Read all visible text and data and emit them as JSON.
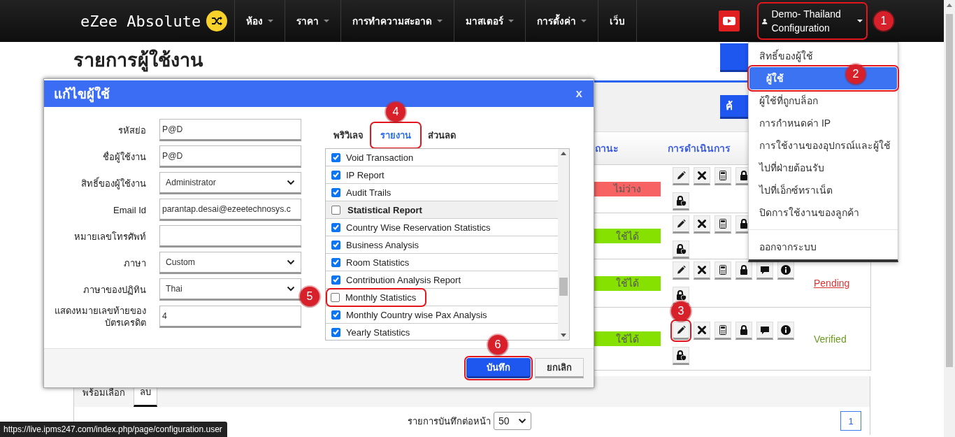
{
  "navbar": {
    "logo": "eZee Absolute",
    "menus": [
      {
        "label": "ห้อง",
        "has_caret": true
      },
      {
        "label": "ราคา",
        "has_caret": true
      },
      {
        "label": "การทำความสะอาด",
        "has_caret": true
      },
      {
        "label": "มาสเตอร์",
        "has_caret": true
      },
      {
        "label": "การตั้งค่า",
        "has_caret": true
      },
      {
        "label": "เว็บ",
        "has_caret": false
      }
    ],
    "user": {
      "label": "Demo- Thailand Configuration",
      "highlighted": true,
      "callout": "1"
    }
  },
  "user_menu": [
    {
      "kind": "item",
      "label": "สิทธิ์ของผู้ใช้",
      "selected": false,
      "highlighted": false
    },
    {
      "kind": "item",
      "label": "ผู้ใช้",
      "selected": true,
      "highlighted": true,
      "callout": "2"
    },
    {
      "kind": "item",
      "label": "ผู้ใช้ที่ถูกบล็อก",
      "selected": false,
      "highlighted": false
    },
    {
      "kind": "item",
      "label": "การกำหนดค่า IP",
      "selected": false,
      "highlighted": false
    },
    {
      "kind": "item",
      "label": "การใช้งานของอุปกรณ์และผู้ใช้",
      "selected": false,
      "highlighted": false
    },
    {
      "kind": "item",
      "label": "ไปที่ฝ่ายต้อนรับ",
      "selected": false,
      "highlighted": false
    },
    {
      "kind": "item",
      "label": "ไปที่เอ็กซ์ทราเน็ต",
      "selected": false,
      "highlighted": false
    },
    {
      "kind": "item",
      "label": "ปิดการใช้งานของลูกค้า",
      "selected": false,
      "highlighted": false
    },
    {
      "kind": "divider"
    },
    {
      "kind": "item",
      "label": "ออกจากระบบ",
      "selected": false,
      "highlighted": false
    }
  ],
  "page": {
    "title": "รายการผู้ใช้งาน",
    "search_button": "ค้",
    "columns": [
      "ถานะ",
      "การดำเนินการ"
    ],
    "rows": [
      {
        "status": "ไม่ว่าง",
        "color": "#f76262",
        "actions": [
          {
            "kind": "edit",
            "highlighted": false
          },
          {
            "kind": "delete",
            "highlighted": false
          },
          {
            "kind": "calculator",
            "highlighted": false
          },
          {
            "kind": "lock",
            "highlighted": false
          },
          {
            "kind": "lock-shield",
            "highlighted": false
          }
        ]
      },
      {
        "status": "ใช้ได้",
        "color": "#86e000",
        "actions": [
          {
            "kind": "edit",
            "highlighted": false
          },
          {
            "kind": "delete",
            "highlighted": false
          },
          {
            "kind": "calculator",
            "highlighted": false
          },
          {
            "kind": "lock",
            "highlighted": false
          },
          {
            "kind": "lock-shield",
            "highlighted": false
          }
        ]
      },
      {
        "status": "ใช้ได้",
        "color": "#86e000",
        "actions": [
          {
            "kind": "edit",
            "highlighted": false
          },
          {
            "kind": "delete",
            "highlighted": false
          },
          {
            "kind": "calculator",
            "highlighted": false
          },
          {
            "kind": "lock",
            "highlighted": false
          },
          {
            "kind": "comment",
            "highlighted": false
          },
          {
            "kind": "info",
            "highlighted": false
          },
          {
            "kind": "lock-shield",
            "highlighted": false
          }
        ],
        "verification": {
          "text": "Pending",
          "kind": "pending"
        }
      },
      {
        "status": "ใช้ได้",
        "color": "#86e000",
        "actions": [
          {
            "kind": "edit",
            "highlighted": true,
            "callout": "3"
          },
          {
            "kind": "delete",
            "highlighted": false
          },
          {
            "kind": "calculator",
            "highlighted": false
          },
          {
            "kind": "lock",
            "highlighted": false
          },
          {
            "kind": "comment",
            "highlighted": false
          },
          {
            "kind": "info",
            "highlighted": false
          },
          {
            "kind": "lock-shield",
            "highlighted": false
          }
        ],
        "verification": {
          "text": "Verified",
          "kind": "verified"
        }
      }
    ],
    "bottom_tabs": [
      {
        "label": "พร้อมเลือก",
        "selected": false
      },
      {
        "label": "ลบ",
        "selected": true
      }
    ],
    "per_page_label": "รายการบันทึกต่อหน้า",
    "per_page": "50",
    "pages": [
      {
        "label": "1",
        "selected": true
      }
    ]
  },
  "dialog": {
    "title": "แก้ไขผู้ใช้",
    "close": "x",
    "fields": [
      {
        "label": "รหัสย่อ",
        "kind": "text",
        "value": "P@D"
      },
      {
        "label": "ชื่อผู้ใช้งาน",
        "kind": "text",
        "value": "P@D"
      },
      {
        "label": "สิทธิ์ของผู้ใช้งาน",
        "kind": "select",
        "value": "Administrator"
      },
      {
        "label": "Email Id",
        "kind": "text",
        "value": "parantap.desai@ezeetechnosys.c"
      },
      {
        "label": "หมายเลขโทรศัพท์",
        "kind": "text"
      },
      {
        "label": "ภาษา",
        "kind": "select",
        "value": "Custom"
      },
      {
        "label": "ภาษาของปฏิทิน",
        "kind": "select",
        "value": "Thai"
      },
      {
        "label": "แสดงหมายเลขท้ายของบัตรเครดิต",
        "kind": "text",
        "value": "4"
      }
    ],
    "tabs": [
      {
        "label": "พริวิเลจ",
        "selected": false,
        "highlighted": false
      },
      {
        "label": "รายงาน",
        "selected": true,
        "highlighted": true,
        "callout": "4"
      },
      {
        "label": "ส่วนลด",
        "selected": false,
        "highlighted": false
      }
    ],
    "report_items": [
      {
        "kind": "item",
        "label": "Void Transaction",
        "checked": true,
        "highlighted": false
      },
      {
        "kind": "item",
        "label": "IP Report",
        "checked": true,
        "highlighted": false
      },
      {
        "kind": "item",
        "label": "Audit Trails",
        "checked": true,
        "highlighted": false
      },
      {
        "kind": "group",
        "label": "Statistical Report",
        "checked": false,
        "highlighted": false
      },
      {
        "kind": "item",
        "label": "Country Wise Reservation Statistics",
        "checked": true,
        "highlighted": false
      },
      {
        "kind": "item",
        "label": "Business Analysis",
        "checked": true,
        "highlighted": false
      },
      {
        "kind": "item",
        "label": "Room Statistics",
        "checked": true,
        "highlighted": false
      },
      {
        "kind": "item",
        "label": "Contribution Analysis Report",
        "checked": true,
        "highlighted": false
      },
      {
        "kind": "item",
        "label": "Monthly Statistics",
        "checked": false,
        "highlighted": true,
        "callout": "5"
      },
      {
        "kind": "item",
        "label": "Monthly Country wise Pax Analysis",
        "checked": true,
        "highlighted": false
      },
      {
        "kind": "item",
        "label": "Yearly Statistics",
        "checked": true,
        "highlighted": false
      }
    ],
    "buttons": [
      {
        "label": "บันทึก",
        "kind": "primary",
        "highlighted": true,
        "callout": "6"
      },
      {
        "label": "ยกเลิก",
        "kind": "default",
        "highlighted": false
      }
    ]
  },
  "status_url": "https://live.ipms247.com/index.php/page/configuration.user"
}
